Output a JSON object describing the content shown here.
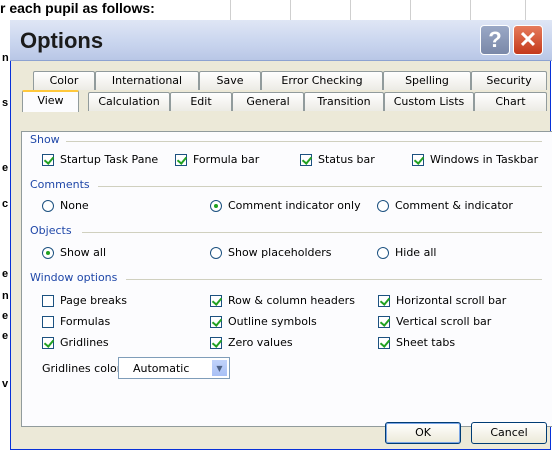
{
  "sheet": {
    "header_text": "r each pupil as follows:",
    "row_letters": [
      "n",
      "s",
      "e",
      "c",
      "e",
      "n",
      "e",
      "e",
      "v"
    ]
  },
  "dialog": {
    "title": "Options",
    "help_label": "?",
    "close_label": "✕",
    "tabs_top": [
      "Color",
      "International",
      "Save",
      "Error Checking",
      "Spelling",
      "Security"
    ],
    "tabs_bottom": [
      "View",
      "Calculation",
      "Edit",
      "General",
      "Transition",
      "Custom Lists",
      "Chart"
    ],
    "active_tab": "View",
    "show": {
      "label": "Show",
      "options": [
        {
          "label": "Startup Task Pane",
          "checked": true
        },
        {
          "label": "Formula bar",
          "checked": true
        },
        {
          "label": "Status bar",
          "checked": true
        },
        {
          "label": "Windows in Taskbar",
          "checked": true
        }
      ]
    },
    "comments": {
      "label": "Comments",
      "options": [
        {
          "label": "None",
          "selected": false
        },
        {
          "label": "Comment indicator only",
          "selected": true
        },
        {
          "label": "Comment & indicator",
          "selected": false
        }
      ]
    },
    "objects": {
      "label": "Objects",
      "options": [
        {
          "label": "Show all",
          "selected": true
        },
        {
          "label": "Show placeholders",
          "selected": false
        },
        {
          "label": "Hide all",
          "selected": false
        }
      ]
    },
    "window_options": {
      "label": "Window options",
      "options": [
        {
          "label": "Page breaks",
          "checked": false
        },
        {
          "label": "Row & column headers",
          "checked": true
        },
        {
          "label": "Horizontal scroll bar",
          "checked": true
        },
        {
          "label": "Formulas",
          "checked": false
        },
        {
          "label": "Outline symbols",
          "checked": true
        },
        {
          "label": "Vertical scroll bar",
          "checked": true
        },
        {
          "label": "Gridlines",
          "checked": true
        },
        {
          "label": "Zero values",
          "checked": true
        },
        {
          "label": "Sheet tabs",
          "checked": true
        }
      ],
      "gridlines_color_label": "Gridlines color:",
      "gridlines_color_value": "Automatic"
    },
    "ok_label": "OK",
    "cancel_label": "Cancel"
  },
  "colors": {
    "title_bar": "#c8d4ee",
    "group_label": "#1f47a8",
    "close": "#c4391b",
    "check": "#21a121"
  }
}
